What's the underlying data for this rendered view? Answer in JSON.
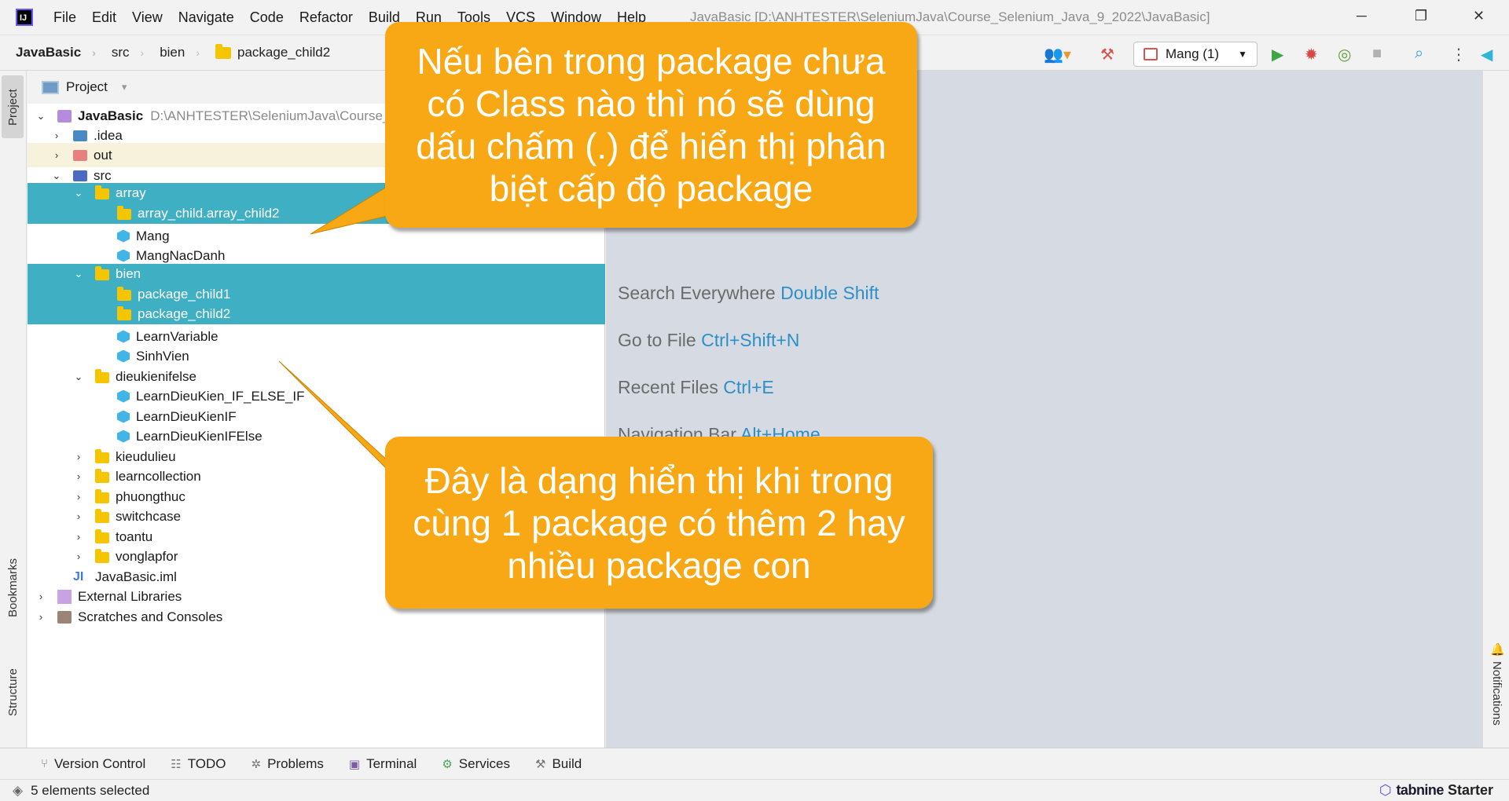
{
  "titlebar": {
    "logo": "IJ",
    "menu": [
      "File",
      "Edit",
      "View",
      "Navigate",
      "Code",
      "Refactor",
      "Build",
      "Run",
      "Tools",
      "VCS",
      "Window",
      "Help"
    ],
    "window_title": "JavaBasic [D:\\ANHTESTER\\SeleniumJava\\Course_Selenium_Java_9_2022\\JavaBasic]",
    "controls": {
      "minimize": "─",
      "restore": "❐",
      "close": "✕"
    }
  },
  "navbar": {
    "breadcrumbs": [
      "JavaBasic",
      "src",
      "bien",
      "package_child2"
    ],
    "run_config": "Mang (1)"
  },
  "side_tabs": {
    "left": [
      "Project",
      "Bookmarks",
      "Structure"
    ],
    "right": [
      "Notifications"
    ]
  },
  "project_panel": {
    "title": "Project",
    "root_name": "JavaBasic",
    "root_path": "D:\\ANHTESTER\\SeleniumJava\\Course_",
    "items": [
      ".idea",
      "out",
      "src",
      "array",
      "array_child.array_child2",
      "Mang",
      "MangNacDanh",
      "bien",
      "package_child1",
      "package_child2",
      "LearnVariable",
      "SinhVien",
      "dieukienifelse",
      "LearnDieuKien_IF_ELSE_IF",
      "LearnDieuKienIF",
      "LearnDieuKienIFElse",
      "kieudulieu",
      "learncollection",
      "phuongthuc",
      "switchcase",
      "toantu",
      "vonglapfor",
      "JavaBasic.iml",
      "External Libraries",
      "Scratches and Consoles"
    ]
  },
  "editor_hints": [
    {
      "label": "Search Everywhere",
      "key": "Double Shift"
    },
    {
      "label": "Go to File",
      "key": "Ctrl+Shift+N"
    },
    {
      "label": "Recent Files",
      "key": "Ctrl+E"
    },
    {
      "label": "Navigation Bar",
      "key": "Alt+Home"
    }
  ],
  "bottom_tabs": [
    "Version Control",
    "TODO",
    "Problems",
    "Terminal",
    "Services",
    "Build"
  ],
  "status": {
    "text": "5 elements selected",
    "brand": "tabnine",
    "plan": "Starter"
  },
  "callouts": {
    "top": "Nếu bên trong package chưa có Class nào thì nó sẽ dùng dấu chấm (.) để hiển thị phân biệt cấp độ package",
    "bottom": "Đây là dạng hiển thị khi trong cùng 1 package có thêm 2 hay nhiều package con"
  },
  "colors": {
    "selection": "#3fb0c4",
    "callout": "#f7a814",
    "editor_bg": "#d6dbe3",
    "hint_key": "#2e8fc6"
  }
}
